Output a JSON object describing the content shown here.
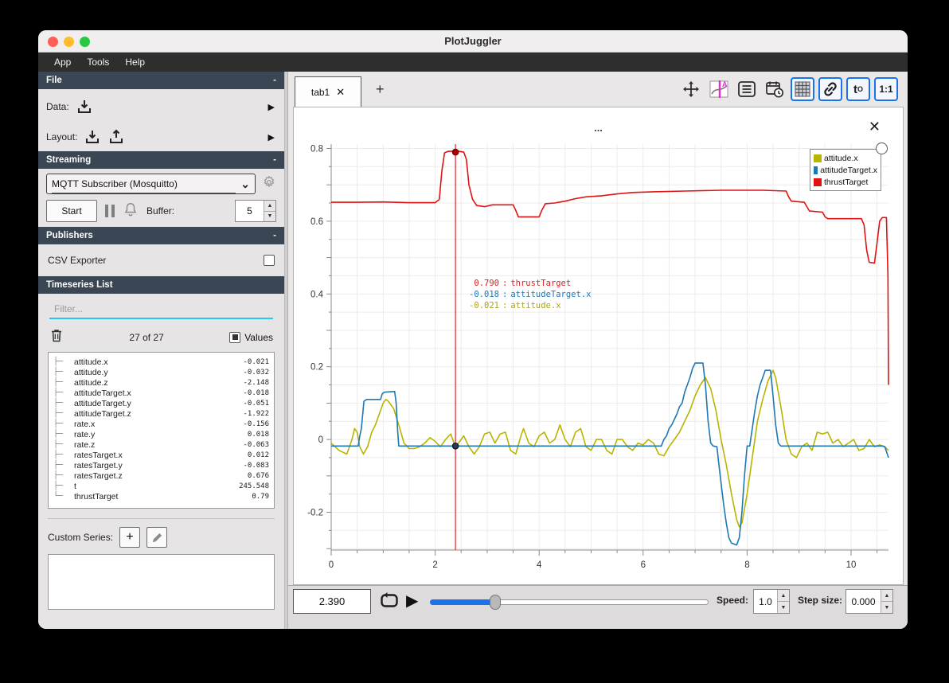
{
  "window": {
    "title": "PlotJuggler",
    "menu": [
      "App",
      "Tools",
      "Help"
    ],
    "minimize_glyph": "-"
  },
  "sidebar": {
    "file": {
      "header": "File",
      "data_label": "Data:",
      "layout_label": "Layout:"
    },
    "streaming": {
      "header": "Streaming",
      "source_selected": "MQTT Subscriber (Mosquitto)",
      "start_label": "Start",
      "buffer_label": "Buffer:",
      "buffer_value": "5"
    },
    "publishers": {
      "header": "Publishers",
      "csv_label": "CSV Exporter"
    },
    "timeseries": {
      "header": "Timeseries List",
      "filter_placeholder": "Filter...",
      "count": "27 of 27",
      "values_label": "Values",
      "custom_label": "Custom Series:",
      "items": [
        {
          "name": "attitude.x",
          "value": "-0.021"
        },
        {
          "name": "attitude.y",
          "value": "-0.032"
        },
        {
          "name": "attitude.z",
          "value": "-2.148"
        },
        {
          "name": "attitudeTarget.x",
          "value": "-0.018"
        },
        {
          "name": "attitudeTarget.y",
          "value": "-0.051"
        },
        {
          "name": "attitudeTarget.z",
          "value": "-1.922"
        },
        {
          "name": "rate.x",
          "value": "-0.156"
        },
        {
          "name": "rate.y",
          "value": "0.018"
        },
        {
          "name": "rate.z",
          "value": "-0.063"
        },
        {
          "name": "ratesTarget.x",
          "value": "0.012"
        },
        {
          "name": "ratesTarget.y",
          "value": "-0.083"
        },
        {
          "name": "ratesTarget.z",
          "value": "0.676"
        },
        {
          "name": "t",
          "value": "245.548"
        },
        {
          "name": "thrustTarget",
          "value": "0.79"
        }
      ]
    }
  },
  "main": {
    "tab_label": "tab1",
    "plot_title": "...",
    "t0_main": "t",
    "t0_sub": "O",
    "ratio_label": "1:1"
  },
  "tooltip": {
    "lines": [
      {
        "value": " 0.790",
        "label": "thrustTarget",
        "color": "#d92121"
      },
      {
        "value": "-0.018",
        "label": "attitudeTarget.x",
        "color": "#1f77b4"
      },
      {
        "value": "-0.021",
        "label": "attitude.x",
        "color": "#a8a520"
      }
    ]
  },
  "playback": {
    "time_value": "2.390",
    "slider_fraction": 0.235,
    "speed_label": "Speed:",
    "speed_value": "1.0",
    "step_label": "Step size:",
    "step_value": "0.000"
  },
  "colors": {
    "accent_blue": "#1a73e8",
    "filter_underline": "#29c5f6",
    "header_bg": "#3a4653",
    "series_olive": "#b8b400",
    "series_blue": "#1f77b4",
    "series_red": "#e01212",
    "traffic_red": "#ff5f57",
    "traffic_yellow": "#febc2e",
    "traffic_green": "#2ac840"
  },
  "chart_data": {
    "type": "line",
    "title": "...",
    "xlabel": "",
    "ylabel": "",
    "xlim": [
      0,
      10.72
    ],
    "ylim": [
      -0.304,
      0.812
    ],
    "x_ticks": [
      0,
      2,
      4,
      6,
      8,
      10
    ],
    "y_ticks": [
      0.8,
      0.6,
      0.4,
      0.2,
      0,
      -0.2
    ],
    "grid": "on",
    "legend_position": "top-right",
    "tracker": {
      "x": 2.39,
      "markers": [
        {
          "y": 0.79,
          "fill": "#b30000",
          "stroke": "#700000"
        },
        {
          "y": -0.018,
          "fill": "#2a3e55",
          "stroke": "#0e1a28"
        }
      ]
    },
    "series": [
      {
        "name": "attitude.x",
        "color": "#b8b400",
        "points": [
          [
            0,
            -0.01
          ],
          [
            0.15,
            -0.03
          ],
          [
            0.3,
            -0.04
          ],
          [
            0.4,
            0.0
          ],
          [
            0.45,
            0.03
          ],
          [
            0.5,
            0.02
          ],
          [
            0.55,
            -0.02
          ],
          [
            0.62,
            -0.04
          ],
          [
            0.7,
            -0.02
          ],
          [
            0.78,
            0.02
          ],
          [
            0.85,
            0.04
          ],
          [
            0.95,
            0.08
          ],
          [
            1.0,
            0.1
          ],
          [
            1.05,
            0.11
          ],
          [
            1.1,
            0.105
          ],
          [
            1.2,
            0.085
          ],
          [
            1.3,
            0.04
          ],
          [
            1.4,
            -0.01
          ],
          [
            1.5,
            -0.025
          ],
          [
            1.6,
            -0.025
          ],
          [
            1.7,
            -0.02
          ],
          [
            1.8,
            -0.01
          ],
          [
            1.9,
            0.005
          ],
          [
            2.0,
            -0.005
          ],
          [
            2.1,
            -0.02
          ],
          [
            2.2,
            0.0
          ],
          [
            2.3,
            0.015
          ],
          [
            2.39,
            -0.021
          ],
          [
            2.5,
            0.0
          ],
          [
            2.55,
            0.01
          ],
          [
            2.65,
            -0.02
          ],
          [
            2.75,
            -0.04
          ],
          [
            2.85,
            -0.02
          ],
          [
            2.95,
            0.015
          ],
          [
            3.05,
            0.02
          ],
          [
            3.15,
            -0.01
          ],
          [
            3.25,
            0.015
          ],
          [
            3.35,
            0.02
          ],
          [
            3.45,
            -0.03
          ],
          [
            3.55,
            -0.04
          ],
          [
            3.65,
            0.01
          ],
          [
            3.7,
            0.03
          ],
          [
            3.8,
            -0.01
          ],
          [
            3.9,
            -0.02
          ],
          [
            4.0,
            0.01
          ],
          [
            4.1,
            0.02
          ],
          [
            4.2,
            -0.01
          ],
          [
            4.3,
            0.0
          ],
          [
            4.4,
            0.04
          ],
          [
            4.5,
            0.0
          ],
          [
            4.6,
            -0.02
          ],
          [
            4.7,
            0.02
          ],
          [
            4.8,
            0.03
          ],
          [
            4.9,
            -0.02
          ],
          [
            5.0,
            -0.03
          ],
          [
            5.1,
            0.0
          ],
          [
            5.2,
            0.0
          ],
          [
            5.3,
            -0.03
          ],
          [
            5.4,
            -0.04
          ],
          [
            5.5,
            0.0
          ],
          [
            5.6,
            0.0
          ],
          [
            5.7,
            -0.02
          ],
          [
            5.8,
            -0.03
          ],
          [
            5.9,
            -0.01
          ],
          [
            6.0,
            -0.015
          ],
          [
            6.1,
            0.0
          ],
          [
            6.2,
            -0.01
          ],
          [
            6.3,
            -0.04
          ],
          [
            6.4,
            -0.045
          ],
          [
            6.5,
            -0.02
          ],
          [
            6.6,
            0.0
          ],
          [
            6.7,
            0.02
          ],
          [
            6.8,
            0.05
          ],
          [
            6.9,
            0.08
          ],
          [
            7.0,
            0.12
          ],
          [
            7.1,
            0.15
          ],
          [
            7.2,
            0.17
          ],
          [
            7.3,
            0.14
          ],
          [
            7.4,
            0.08
          ],
          [
            7.5,
            0.0
          ],
          [
            7.6,
            -0.07
          ],
          [
            7.7,
            -0.15
          ],
          [
            7.8,
            -0.22
          ],
          [
            7.85,
            -0.24
          ],
          [
            7.9,
            -0.23
          ],
          [
            8.0,
            -0.15
          ],
          [
            8.1,
            -0.05
          ],
          [
            8.2,
            0.05
          ],
          [
            8.3,
            0.11
          ],
          [
            8.4,
            0.16
          ],
          [
            8.5,
            0.19
          ],
          [
            8.55,
            0.17
          ],
          [
            8.65,
            0.09
          ],
          [
            8.75,
            0.0
          ],
          [
            8.85,
            -0.04
          ],
          [
            8.95,
            -0.05
          ],
          [
            9.05,
            -0.02
          ],
          [
            9.15,
            -0.01
          ],
          [
            9.25,
            -0.03
          ],
          [
            9.35,
            0.02
          ],
          [
            9.45,
            0.015
          ],
          [
            9.55,
            0.02
          ],
          [
            9.65,
            -0.01
          ],
          [
            9.75,
            0.0
          ],
          [
            9.85,
            -0.02
          ],
          [
            9.95,
            -0.01
          ],
          [
            10.05,
            0.0
          ],
          [
            10.15,
            -0.03
          ],
          [
            10.25,
            -0.025
          ],
          [
            10.35,
            0.0
          ],
          [
            10.45,
            -0.02
          ],
          [
            10.55,
            -0.015
          ],
          [
            10.65,
            -0.02
          ],
          [
            10.72,
            -0.03
          ]
        ]
      },
      {
        "name": "attitudeTarget.x",
        "color": "#1f77b4",
        "points": [
          [
            0,
            -0.018
          ],
          [
            0.52,
            -0.018
          ],
          [
            0.55,
            0.01
          ],
          [
            0.58,
            0.03
          ],
          [
            0.6,
            0.06
          ],
          [
            0.63,
            0.105
          ],
          [
            0.68,
            0.11
          ],
          [
            0.95,
            0.11
          ],
          [
            0.98,
            0.125
          ],
          [
            1.02,
            0.13
          ],
          [
            1.22,
            0.132
          ],
          [
            1.25,
            0.1
          ],
          [
            1.28,
            0.02
          ],
          [
            1.3,
            -0.018
          ],
          [
            6.35,
            -0.018
          ],
          [
            6.4,
            0.0
          ],
          [
            6.45,
            0.01
          ],
          [
            6.5,
            0.03
          ],
          [
            6.55,
            0.04
          ],
          [
            6.6,
            0.055
          ],
          [
            6.65,
            0.07
          ],
          [
            6.7,
            0.09
          ],
          [
            6.75,
            0.1
          ],
          [
            6.8,
            0.13
          ],
          [
            6.85,
            0.15
          ],
          [
            6.9,
            0.17
          ],
          [
            6.95,
            0.195
          ],
          [
            7.0,
            0.21
          ],
          [
            7.15,
            0.21
          ],
          [
            7.2,
            0.15
          ],
          [
            7.25,
            0.05
          ],
          [
            7.3,
            -0.01
          ],
          [
            7.35,
            -0.018
          ],
          [
            7.42,
            -0.02
          ],
          [
            7.45,
            -0.06
          ],
          [
            7.5,
            -0.12
          ],
          [
            7.55,
            -0.18
          ],
          [
            7.6,
            -0.23
          ],
          [
            7.65,
            -0.27
          ],
          [
            7.7,
            -0.285
          ],
          [
            7.8,
            -0.29
          ],
          [
            7.85,
            -0.27
          ],
          [
            7.9,
            -0.2
          ],
          [
            7.95,
            -0.1
          ],
          [
            8.0,
            -0.018
          ],
          [
            8.05,
            -0.018
          ],
          [
            8.1,
            0.03
          ],
          [
            8.15,
            0.08
          ],
          [
            8.2,
            0.12
          ],
          [
            8.25,
            0.15
          ],
          [
            8.3,
            0.17
          ],
          [
            8.35,
            0.19
          ],
          [
            8.45,
            0.19
          ],
          [
            8.5,
            0.12
          ],
          [
            8.55,
            0.04
          ],
          [
            8.6,
            -0.01
          ],
          [
            8.65,
            -0.018
          ],
          [
            10.6,
            -0.018
          ],
          [
            10.65,
            -0.02
          ],
          [
            10.72,
            -0.05
          ]
        ]
      },
      {
        "name": "thrustTarget",
        "color": "#e01212",
        "points": [
          [
            0,
            0.652
          ],
          [
            0.5,
            0.652
          ],
          [
            1.0,
            0.653
          ],
          [
            1.5,
            0.651
          ],
          [
            2.0,
            0.651
          ],
          [
            2.08,
            0.66
          ],
          [
            2.13,
            0.74
          ],
          [
            2.18,
            0.788
          ],
          [
            2.25,
            0.792
          ],
          [
            2.45,
            0.792
          ],
          [
            2.55,
            0.79
          ],
          [
            2.6,
            0.77
          ],
          [
            2.65,
            0.7
          ],
          [
            2.72,
            0.66
          ],
          [
            2.8,
            0.643
          ],
          [
            2.95,
            0.64
          ],
          [
            3.1,
            0.645
          ],
          [
            3.5,
            0.645
          ],
          [
            3.55,
            0.63
          ],
          [
            3.6,
            0.612
          ],
          [
            4.0,
            0.612
          ],
          [
            4.05,
            0.63
          ],
          [
            4.12,
            0.648
          ],
          [
            4.3,
            0.65
          ],
          [
            4.5,
            0.655
          ],
          [
            4.7,
            0.662
          ],
          [
            4.9,
            0.667
          ],
          [
            5.2,
            0.67
          ],
          [
            5.5,
            0.675
          ],
          [
            5.8,
            0.679
          ],
          [
            6.2,
            0.681
          ],
          [
            6.8,
            0.683
          ],
          [
            7.5,
            0.685
          ],
          [
            8.3,
            0.685
          ],
          [
            8.75,
            0.683
          ],
          [
            8.8,
            0.667
          ],
          [
            8.85,
            0.655
          ],
          [
            9.1,
            0.652
          ],
          [
            9.15,
            0.64
          ],
          [
            9.2,
            0.628
          ],
          [
            9.45,
            0.625
          ],
          [
            9.5,
            0.612
          ],
          [
            9.55,
            0.607
          ],
          [
            10.2,
            0.607
          ],
          [
            10.25,
            0.59
          ],
          [
            10.3,
            0.52
          ],
          [
            10.35,
            0.487
          ],
          [
            10.45,
            0.485
          ],
          [
            10.5,
            0.54
          ],
          [
            10.55,
            0.6
          ],
          [
            10.6,
            0.61
          ],
          [
            10.68,
            0.61
          ],
          [
            10.71,
            0.45
          ],
          [
            10.72,
            0.15
          ]
        ]
      }
    ]
  }
}
